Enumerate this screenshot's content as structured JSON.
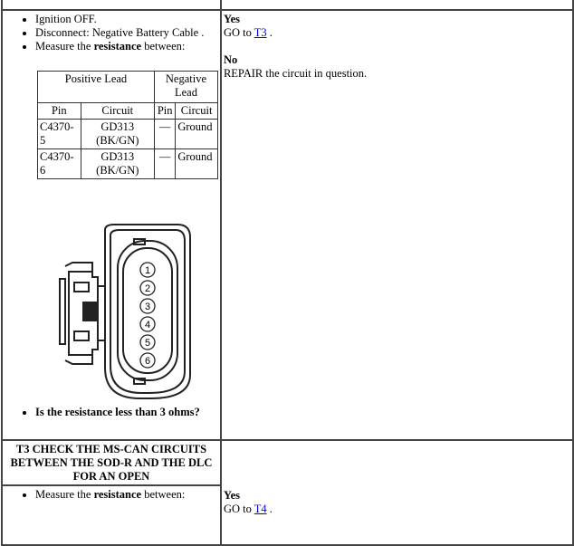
{
  "step_t2": {
    "instructions": [
      "Ignition OFF.",
      "Disconnect: Negative Battery Cable .",
      "Measure the "
    ],
    "measure_bold": "resistance",
    "measure_suffix": " between:",
    "table": {
      "group_headers": [
        "Positive Lead",
        "Negative Lead"
      ],
      "columns": [
        "Pin",
        "Circuit",
        "Pin",
        "Circuit"
      ],
      "rows": [
        {
          "pos_pin": "C4370-5",
          "pos_circuit": "GD313 (BK/GN)",
          "neg_pin": "—",
          "neg_circuit": "Ground"
        },
        {
          "pos_pin": "C4370-6",
          "pos_circuit": "GD313 (BK/GN)",
          "neg_pin": "—",
          "neg_circuit": "Ground"
        }
      ]
    },
    "connector_pins": [
      "1",
      "2",
      "3",
      "4",
      "5",
      "6"
    ],
    "question": "Is the resistance less than 3 ohms?",
    "yes_label": "Yes",
    "yes_text": "GO to ",
    "yes_link": "T3",
    "yes_end": " .",
    "no_label": "No",
    "no_text": "REPAIR the circuit in question."
  },
  "step_t3": {
    "title": "T3 CHECK THE MS-CAN CIRCUITS BETWEEN THE SOD-R AND THE DLC FOR AN OPEN",
    "instruction_prefix": "Measure the ",
    "instruction_bold": "resistance",
    "instruction_suffix": " between:",
    "yes_label": "Yes",
    "yes_text": "GO to ",
    "yes_link": "T4",
    "yes_end": " ."
  }
}
